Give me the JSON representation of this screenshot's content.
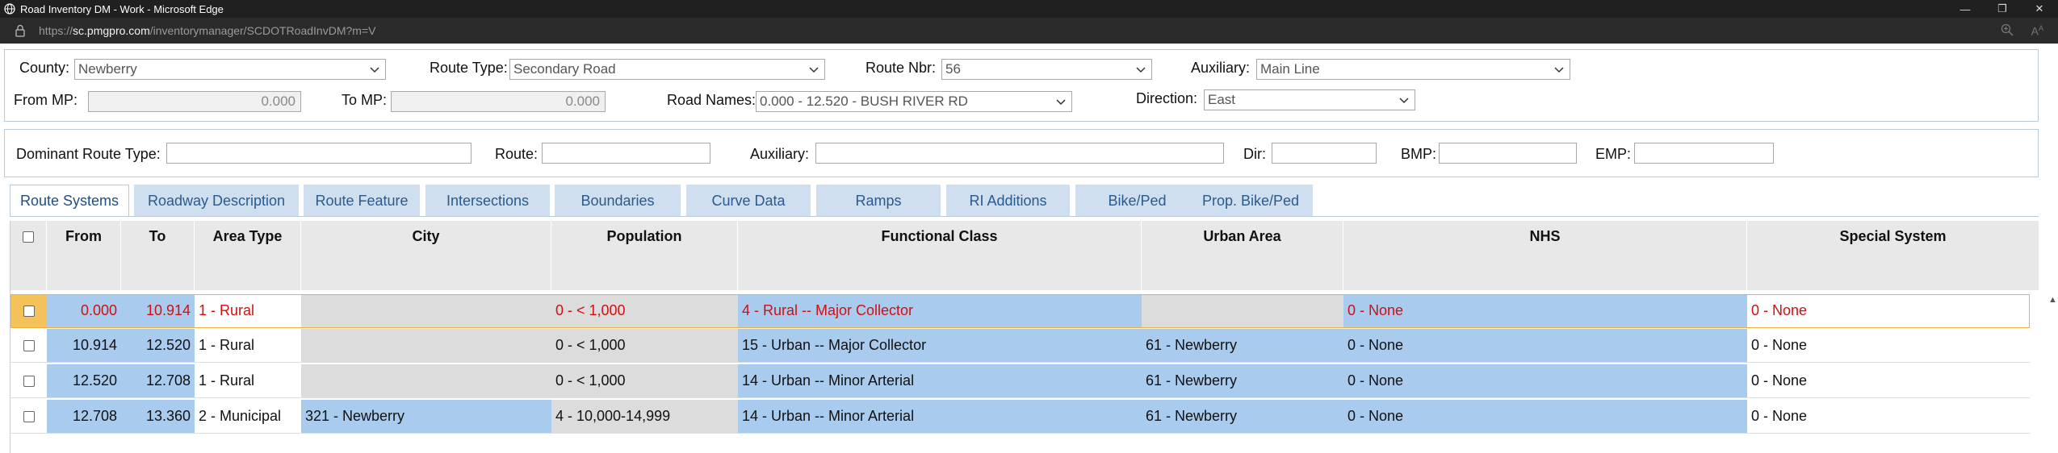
{
  "window": {
    "title": "Road Inventory DM - Work - Microsoft Edge"
  },
  "address": {
    "prefix": "https://",
    "host": "sc.pmgpro.com",
    "path": "/inventorymanager/SCDOTRoadInvDM?m=V"
  },
  "filters": {
    "county_label": "County:",
    "county_value": "Newberry",
    "route_type_label": "Route Type:",
    "route_type_value": "Secondary Road",
    "route_nbr_label": "Route Nbr:",
    "route_nbr_value": "56",
    "auxiliary_label": "Auxiliary:",
    "auxiliary_value": "Main Line",
    "from_mp_label": "From MP:",
    "from_mp_value": "0.000",
    "to_mp_label": "To MP:",
    "to_mp_value": "0.000",
    "road_names_label": "Road Names:",
    "road_names_value": "0.000 - 12.520 - BUSH RIVER RD",
    "direction_label": "Direction:",
    "direction_value": "East"
  },
  "dominant": {
    "dominant_route_type_label": "Dominant Route Type:",
    "dominant_route_type_value": "",
    "route_label": "Route:",
    "route_value": "",
    "auxiliary_label": "Auxiliary:",
    "auxiliary_value": "",
    "dir_label": "Dir:",
    "dir_value": "",
    "bmp_label": "BMP:",
    "bmp_value": "",
    "emp_label": "EMP:",
    "emp_value": ""
  },
  "tabs": [
    {
      "label": "Route Systems",
      "active": true
    },
    {
      "label": "Roadway Description"
    },
    {
      "label": "Route Feature"
    },
    {
      "label": "Intersections"
    },
    {
      "label": "Boundaries"
    },
    {
      "label": "Curve Data"
    },
    {
      "label": "Ramps"
    },
    {
      "label": "RI Additions"
    },
    {
      "label": "Bike/Ped"
    },
    {
      "label": "Prop. Bike/Ped"
    }
  ],
  "table": {
    "columns": [
      "From",
      "To",
      "Area Type",
      "City",
      "Population",
      "Functional Class",
      "Urban Area",
      "NHS",
      "Special System"
    ],
    "rows": [
      {
        "from": "0.000",
        "to": "10.914",
        "area_type": "1 - Rural",
        "city": "",
        "population": "0 - < 1,000",
        "functional_class": "4 - Rural -- Major Collector",
        "urban_area": "",
        "nhs": "0 - None",
        "special_system": "0 - None",
        "selected": true
      },
      {
        "from": "10.914",
        "to": "12.520",
        "area_type": "1 - Rural",
        "city": "",
        "population": "0 - < 1,000",
        "functional_class": "15 - Urban -- Major Collector",
        "urban_area": "61 - Newberry",
        "nhs": "0 - None",
        "special_system": "0 - None"
      },
      {
        "from": "12.520",
        "to": "12.708",
        "area_type": "1 - Rural",
        "city": "",
        "population": "0 - < 1,000",
        "functional_class": "14 - Urban -- Minor Arterial",
        "urban_area": "61 - Newberry",
        "nhs": "0 - None",
        "special_system": "0 - None"
      },
      {
        "from": "12.708",
        "to": "13.360",
        "area_type": "2 - Municipal",
        "city": "321 - Newberry",
        "population": "4 - 10,000-14,999",
        "functional_class": "14 - Urban -- Minor Arterial",
        "urban_area": "61 - Newberry",
        "nhs": "0 - None",
        "special_system": "0 - None"
      }
    ]
  },
  "colors": {
    "selected_text": "#d01010",
    "tab_bg": "#cfdff0",
    "cell_blue": "#a8cbee"
  }
}
